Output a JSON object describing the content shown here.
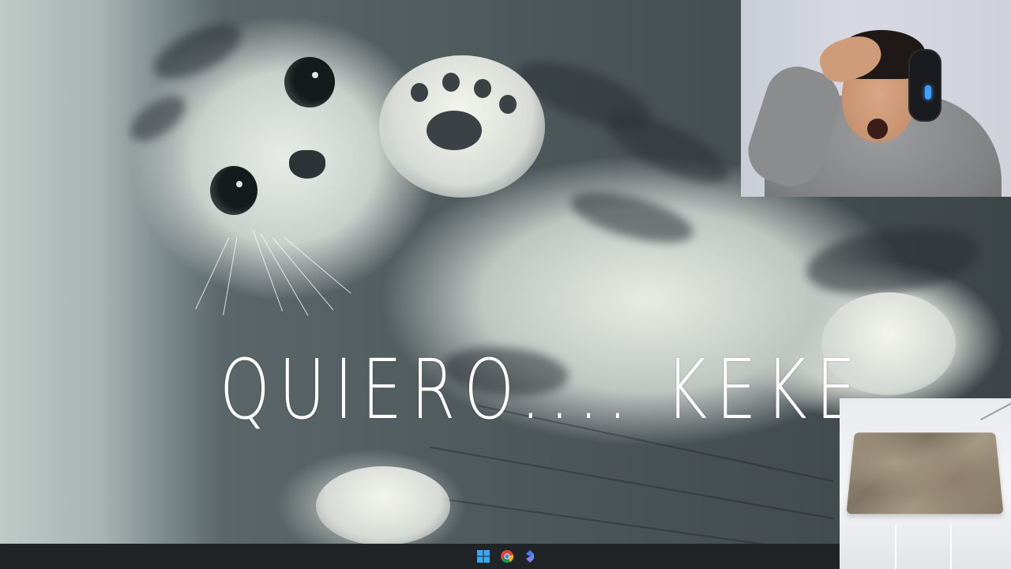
{
  "video": {
    "caption": "QUIERO.... KEKE"
  },
  "taskbar": {
    "icons": [
      "windows-start-icon",
      "chrome-icon",
      "blue-app-icon"
    ]
  },
  "colors": {
    "caption_text": "#ffffff",
    "taskbar_bg": "#202427",
    "headphone_light": "#3da0ff"
  }
}
